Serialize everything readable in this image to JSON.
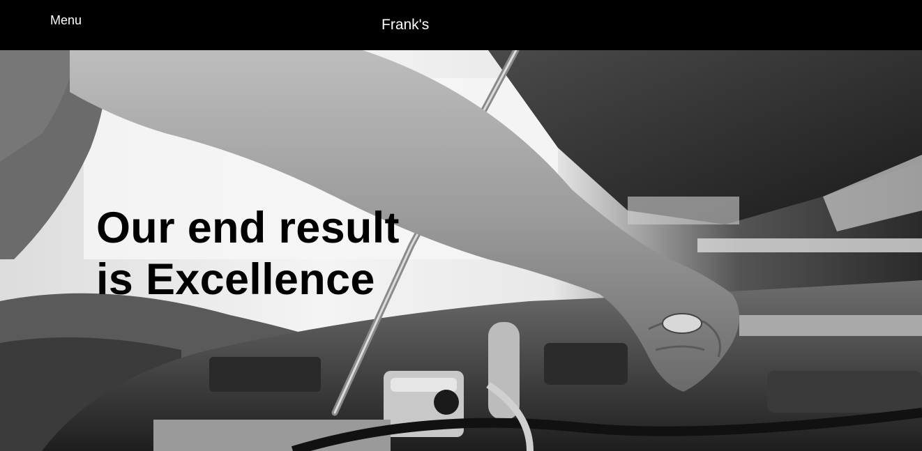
{
  "header": {
    "menu_label": "Menu",
    "brand": "Frank's"
  },
  "hero": {
    "headline_line1": "Our end result",
    "headline_line2": "is Excellence",
    "image_alt": "mechanic-working-on-engine-photo"
  },
  "colors": {
    "topbar_background": "#000000",
    "topbar_text": "#ffffff",
    "headline_text": "#000000"
  }
}
